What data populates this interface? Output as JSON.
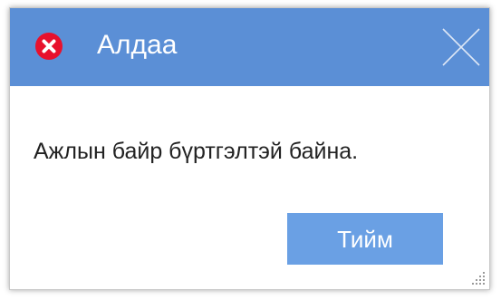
{
  "dialog": {
    "title": "Алдаа",
    "title_icon": "error-icon",
    "close_icon": "close-icon",
    "message": "Ажлын байр бүртгэлтэй байна.",
    "ok_label": "Тийм",
    "resize_icon": "resize-grip-icon"
  },
  "colors": {
    "titlebar": "#5b8fd6",
    "button": "#6aa0e4",
    "error_red": "#e8112d",
    "text": "#222222"
  }
}
